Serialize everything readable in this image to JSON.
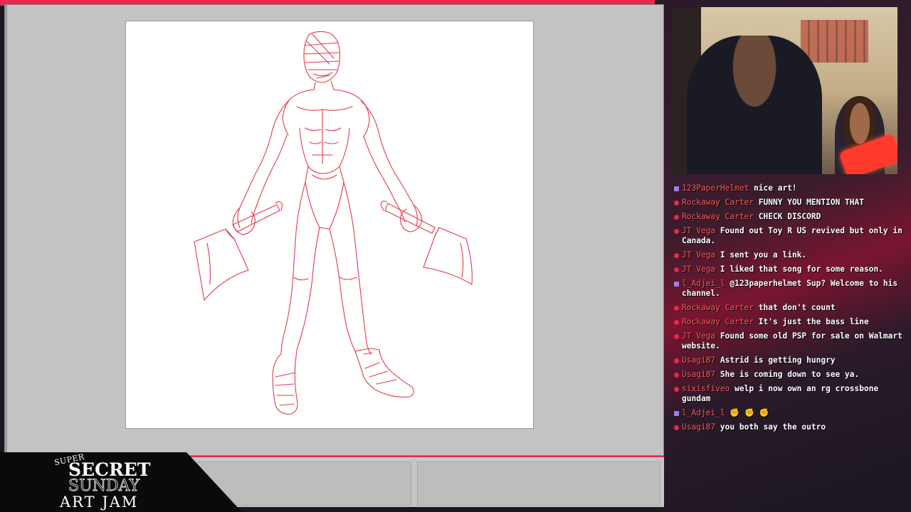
{
  "logo": {
    "super": "SUPER",
    "secret": "SECRET",
    "sunday": "SUNDAY",
    "art_jam": "ART JAM"
  },
  "chat": {
    "messages": [
      {
        "badge": "square",
        "user": "123PaperHelmet",
        "text": "nice art!"
      },
      {
        "badge": "round",
        "user": "Rockaway Carter",
        "text": "FUNNY YOU MENTION THAT"
      },
      {
        "badge": "round",
        "user": "Rockaway Carter",
        "text": "CHECK DISCORD"
      },
      {
        "badge": "round",
        "user": "JT Vega",
        "text": "Found out Toy R US revived but only in Canada."
      },
      {
        "badge": "round",
        "user": "JT Vega",
        "text": "I sent you a link."
      },
      {
        "badge": "round",
        "user": "JT Vega",
        "text": "I liked that song for some reason."
      },
      {
        "badge": "square",
        "user": "l_Adjei_l",
        "text": "@123paperhelmet Sup? Welcome to his channel."
      },
      {
        "badge": "round",
        "user": "Rockaway Carter",
        "text": "that don't count"
      },
      {
        "badge": "round",
        "user": "Rockaway Carter",
        "text": "It's just the bass line"
      },
      {
        "badge": "round",
        "user": "JT Vega",
        "text": "Found some old PSP for sale on Walmart website."
      },
      {
        "badge": "round",
        "user": "Usagi87",
        "text": "Astrid is getting hungry"
      },
      {
        "badge": "round",
        "user": "Usagi87",
        "text": "She is coming down to see ya."
      },
      {
        "badge": "round",
        "user": "sixisfiveo",
        "text": "welp i now own an rg crossbone gundam"
      },
      {
        "badge": "square",
        "user": "l_Adjei_l",
        "text": "✊ ✊ ✊"
      },
      {
        "badge": "round",
        "user": "Usagi87",
        "text": "you both say the outro"
      }
    ]
  },
  "colors": {
    "accent": "#e8284e",
    "username": "#ff5a5a",
    "sketch_line": "#e23a48"
  }
}
